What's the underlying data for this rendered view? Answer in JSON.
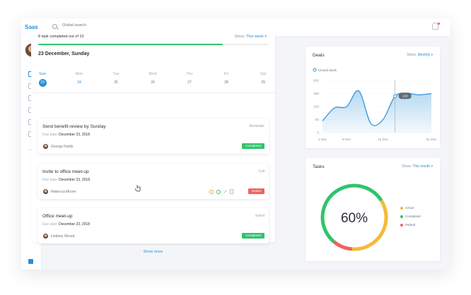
{
  "app": {
    "logo": "Saas"
  },
  "search": {
    "placeholder": "Global search"
  },
  "sidebar": {
    "more": "..."
  },
  "tasks_panel": {
    "summary": "8 task completed out of 10",
    "show_label": "Show:",
    "show_value": "This week",
    "progress": 0.8,
    "date_title": "23 December, Sunday",
    "week": [
      {
        "name": "Sun",
        "date": "23",
        "state": "active"
      },
      {
        "name": "Mon",
        "date": "24",
        "state": "today"
      },
      {
        "name": "Tue",
        "date": "25",
        "state": ""
      },
      {
        "name": "Wed",
        "date": "26",
        "state": ""
      },
      {
        "name": "Thu",
        "date": "27",
        "state": ""
      },
      {
        "name": "Fri",
        "date": "28",
        "state": ""
      },
      {
        "name": "Sat",
        "date": "29",
        "state": ""
      }
    ],
    "tasks": [
      {
        "title": "Send benefit review by Sunday",
        "type": "Reminder",
        "due_label": "Due date:",
        "due": "December 23, 2018",
        "person": "George Fields",
        "status": "Completed",
        "status_color": "green"
      },
      {
        "title": "Invite to office meet-up",
        "type": "Call",
        "due_label": "Due date:",
        "due": "December 23, 2018",
        "person": "Rebecca Moore",
        "status": "Ended",
        "status_color": "red"
      },
      {
        "title": "Office meet-up",
        "type": "Event",
        "due_label": "Due date:",
        "due": "December 23, 2018",
        "person": "Lindsey Stroud",
        "status": "Completed",
        "status_color": "green"
      }
    ],
    "show_more": "Show more"
  },
  "deals": {
    "title": "Deals",
    "show_label": "Show:",
    "show_value": "Monthly",
    "legend": "Closed deals",
    "tooltip": "140"
  },
  "chart_data": {
    "type": "area",
    "title": "",
    "series": [
      {
        "name": "Closed deals",
        "x": [
          "1 Dec",
          "4 Dec",
          "8 Dec",
          "11 Dec",
          "14 Dec",
          "16 Dec",
          "19 Dec",
          "22 Dec",
          "26 Dec",
          "31 Dec"
        ],
        "values": [
          45,
          95,
          100,
          160,
          35,
          50,
          140,
          150,
          145,
          150
        ]
      }
    ],
    "x_ticks": [
      "1 Dec",
      "8 Dec",
      "16 Dec",
      "31 Dec"
    ],
    "y_ticks": [
      0,
      50,
      100,
      150,
      200
    ],
    "ylim": [
      0,
      200
    ],
    "color": "#2a8fd8"
  },
  "tasks_widget": {
    "title": "Tasks",
    "show_label": "Show:",
    "show_value": "This month",
    "percent": "60%",
    "segments": [
      {
        "label": "Active",
        "color": "#f5b93b",
        "value": 0.35
      },
      {
        "label": "Completed",
        "color": "#2fc46c",
        "value": 0.55
      },
      {
        "label": "Parked",
        "color": "#f0625e",
        "value": 0.1
      }
    ]
  }
}
